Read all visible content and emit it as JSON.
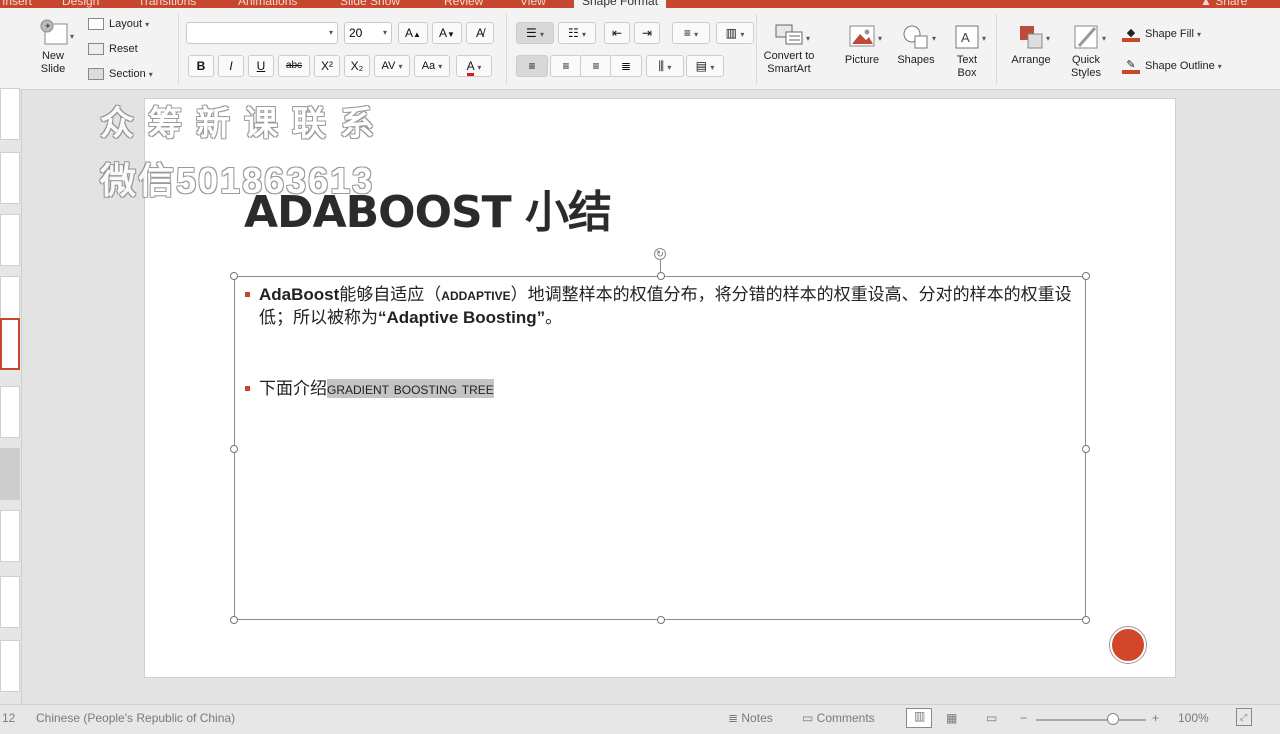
{
  "tabs": [
    "Insert",
    "Design",
    "Transitions",
    "Animations",
    "Slide Show",
    "Review",
    "View",
    "Shape Format"
  ],
  "active_tab": "Shape Format",
  "share_label": "Share",
  "ribbon": {
    "new_slide": "New\nSlide",
    "layout": "Layout",
    "reset": "Reset",
    "section": "Section",
    "font_name": "",
    "font_size": "20",
    "bold": "B",
    "italic": "I",
    "underline": "U",
    "strike": "abc",
    "superscript": "X²",
    "subscript": "X₂",
    "char_spacing": "AV",
    "change_case": "Aa",
    "font_color": "A",
    "increase_font": "A",
    "decrease_font": "A",
    "convert_smartart": "Convert to\nSmartArt",
    "picture": "Picture",
    "shapes": "Shapes",
    "text_box": "Text\nBox",
    "arrange": "Arrange",
    "quick_styles": "Quick\nStyles",
    "shape_fill": "Shape Fill",
    "shape_outline": "Shape Outline"
  },
  "watermark": {
    "line1": "众筹新课联系",
    "line2": "微信501863613"
  },
  "slide": {
    "title": "ADABOOST 小结",
    "bullet1_bold1": "AdaBoost",
    "bullet1_text1": "能够自适应（",
    "bullet1_bold2": "addaptive",
    "bullet1_text2": "）地调整样本的权值分布，将分错的样本的权重设高、分对的样本的权重设低；所以被称为",
    "bullet1_bold3": "“Adaptive Boosting”",
    "bullet1_end": "。",
    "bullet2_text": "下面介绍",
    "bullet2_highlight": "gradient boosting tree"
  },
  "status": {
    "slide_num": "12",
    "language": "Chinese (People's Republic of China)",
    "notes": "Notes",
    "comments": "Comments",
    "zoom": "100%",
    "zoom_level": 0.72
  },
  "colors": {
    "accent": "#c7472e",
    "bullet": "#c7472e",
    "record": "#d2462a"
  }
}
